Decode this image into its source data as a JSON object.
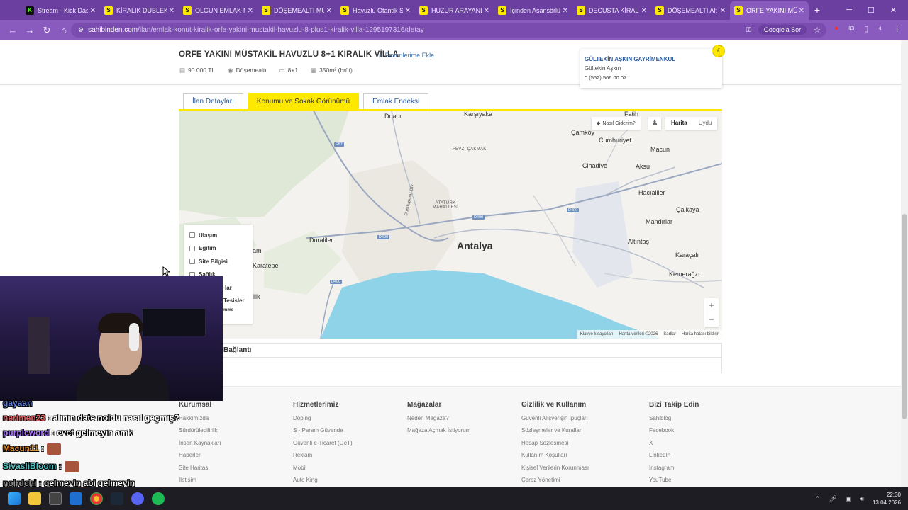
{
  "browser": {
    "tabs": [
      {
        "label": "Stream - Kick Dashboard",
        "favicon": "K",
        "color": "#53fc18",
        "active": false
      },
      {
        "label": "KİRALIK DUBLEKS",
        "favicon": "S",
        "color": "#ffe800",
        "active": false
      },
      {
        "label": "OLGUN EMLAK-M",
        "favicon": "S",
        "color": "#ffe800",
        "active": false
      },
      {
        "label": "DÖŞEMEALTI MÜ",
        "favicon": "S",
        "color": "#ffe800",
        "active": false
      },
      {
        "label": "Havuzlu Otantik S",
        "favicon": "S",
        "color": "#ffe800",
        "active": false
      },
      {
        "label": "HUZUR ARAYANL",
        "favicon": "S",
        "color": "#ffe800",
        "active": false
      },
      {
        "label": "İçinden Asansörlü",
        "favicon": "S",
        "color": "#ffe800",
        "active": false
      },
      {
        "label": "DECUSTA KİRALIK",
        "favicon": "S",
        "color": "#ffe800",
        "active": false
      },
      {
        "label": "DÖŞEMEALTI Alt",
        "favicon": "S",
        "color": "#ffe800",
        "active": false
      },
      {
        "label": "ORFE YAKINI MÜ",
        "favicon": "S",
        "color": "#ffe800",
        "active": true
      }
    ],
    "new_tab": "+",
    "window_controls": {
      "minimize": "─",
      "maximize": "☐",
      "close": "✕"
    },
    "address": {
      "host": "sahibinden.com",
      "path": "/ilan/emlak-konut-kiralik-orfe-yakini-mustakil-havuzlu-8-plus1-kiralik-villa-1295197316/detay"
    },
    "google_label": "Google'a Sor"
  },
  "listing": {
    "title": "ORFE YAKINI MÜSTAKİL HAVUZLU 8+1 KİRALIK VİLLA",
    "favorite": "Favorilerime Ekle",
    "price": "90.000 TL",
    "location": "Döşemealtı",
    "rooms": "8+1",
    "area": "350m² (brüt)"
  },
  "agent": {
    "firm": "GÜLTEKİN AŞKIN GAYRİMENKUL",
    "person": "Gültekin Aşkın",
    "phone": "0 (552) 566 00 07"
  },
  "page_tabs": [
    {
      "label": "İlan Detayları",
      "active": false
    },
    {
      "label": "Konumu ve Sokak Görünümü",
      "active": true
    },
    {
      "label": "Emlak Endeksi",
      "active": false
    }
  ],
  "map": {
    "labels": {
      "karsiyaka": "Karşıyaka",
      "duaci": "Duacı",
      "fatih": "Fatih",
      "camkoy": "Çamköy",
      "cumhuriyet": "Cumhuriyet",
      "fevzi": "FEVZİ ÇAKMAK",
      "macun": "Macun",
      "cihadiye": "Cihadiye",
      "aksu": "Aksu",
      "hacialiler": "Hacıaliler",
      "ataturk": "ATATÜRK MAHALLESİ",
      "calkaya": "Çalkaya",
      "mandirlar": "Mandırlar",
      "duraliler": "Duraliler",
      "antalya": "Antalya",
      "altintas": "Altıntaş",
      "karacali": "Karaçalı",
      "karatepe": "Karatepe",
      "kemeragzi": "Kemerağzı",
      "dumlupinar": "Dumlupınar Blv",
      "am": "am",
      "ilik": "ilik"
    },
    "roads": {
      "d400a": "D400",
      "d400b": "D400",
      "d400c": "D400",
      "d400d": "D400",
      "e87": "E87"
    },
    "nasil_giderim": "Nasıl Giderim?",
    "map_type": [
      "Harita",
      "Uydu"
    ],
    "zoom_in": "+",
    "zoom_out": "−",
    "attribution": [
      "Klavye kısayolları",
      "Harita verileri ©2026",
      "Şartlar",
      "Harita hatası bildirin"
    ],
    "poi": [
      "Ulaşım",
      "Eğitim",
      "Site Bilgisi",
      "Sağlık",
      "lar",
      "Tesisler",
      "mme"
    ]
  },
  "baglanti": "Bağlantı",
  "footer": {
    "columns": [
      {
        "heading": "Kurumsal",
        "links": [
          "Hakkımızda",
          "Sürdürülebilirlik",
          "İnsan Kaynakları",
          "Haberler",
          "Site Haritası",
          "İletişim"
        ]
      },
      {
        "heading": "Hizmetlerimiz",
        "links": [
          "Doping",
          "S - Param Güvende",
          "Güvenli e-Ticaret (GeT)",
          "Reklam",
          "Mobil",
          "Auto King"
        ]
      },
      {
        "heading": "Mağazalar",
        "links": [
          "Neden Mağaza?",
          "Mağaza Açmak İstiyorum"
        ]
      },
      {
        "heading": "Gizlilik ve Kullanım",
        "links": [
          "Güvenli Alışverişin İpuçları",
          "Sözleşmeler ve Kurallar",
          "Hesap Sözleşmesi",
          "Kullanım Koşulları",
          "Kişisel Verilerin Korunması",
          "Çerez Yönetimi"
        ]
      },
      {
        "heading": "Bizi Takip Edin",
        "links": [
          "Sahiblog",
          "Facebook",
          "X",
          "LinkedIn",
          "Instagram",
          "YouTube"
        ]
      }
    ]
  },
  "chat": [
    {
      "user": "gayaan",
      "color": "#5b7bd6",
      "text": ""
    },
    {
      "user": "nerimen23",
      "color": "#e05a5a",
      "text": ": alinin date noldu nasıl geçmiş?"
    },
    {
      "user": "purpleword",
      "color": "#a970ff",
      "text": ": evet gelmeyin amk"
    },
    {
      "user": "Macun11",
      "color": "#e08a2a",
      "text": ":"
    },
    {
      "user": "SivasliBloom",
      "color": "#4fc3c3",
      "text": ":"
    },
    {
      "user": "noirdchi",
      "color": "#8f8f8f",
      "text": ": gelmeyin abi gelmeyin"
    }
  ],
  "taskbar": {
    "time": "22:30",
    "date": "13.04.2026"
  }
}
